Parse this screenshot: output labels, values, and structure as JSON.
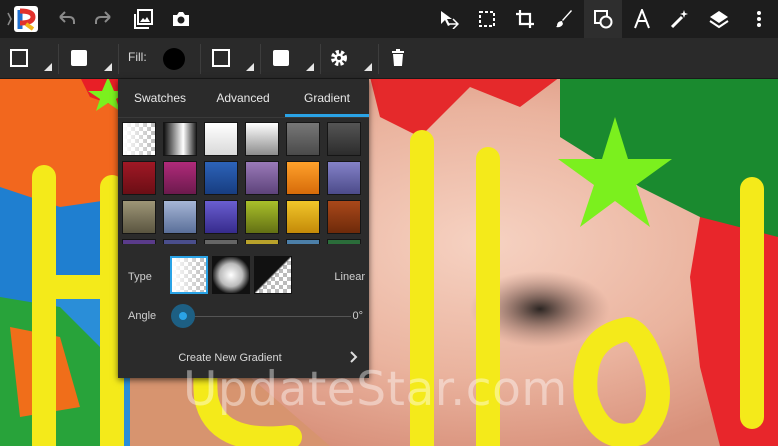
{
  "toolbar": {
    "icons": [
      "app-logo-icon",
      "undo-icon",
      "redo-icon",
      "image-icon",
      "camera-icon",
      "move-select-icon",
      "select-rect-icon",
      "crop-icon",
      "brush-icon",
      "shape-icon",
      "text-icon",
      "magic-wand-icon",
      "layers-icon",
      "more-vert-icon"
    ]
  },
  "options": {
    "fill_label": "Fill:"
  },
  "panel": {
    "tabs": [
      "Swatches",
      "Advanced",
      "Gradient"
    ],
    "active_tab": "Gradient",
    "type_label": "Type",
    "type_value": "Linear",
    "angle_label": "Angle",
    "angle_value": "0°",
    "create_label": "Create New Gradient"
  },
  "watermark": "UpdateStar.com",
  "colors": {
    "accent": "#2aa3e6",
    "toolbar": "#1d1d1d",
    "panel": "#2b2b2b"
  }
}
